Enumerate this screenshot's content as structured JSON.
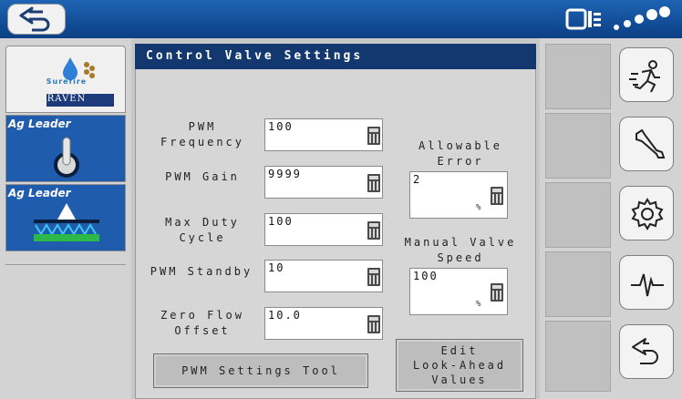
{
  "screen": {
    "title": "Control Valve Settings"
  },
  "topbar": {
    "back_icon": "back-arrow-icon",
    "status_icons": [
      "module-icon",
      "signal-icon"
    ]
  },
  "left_panel": {
    "items": [
      {
        "brand": "Surefire",
        "sub": "RAVEN",
        "icon": "surefire-raven-logo"
      },
      {
        "brand": "Ag Leader",
        "icon": "toggle-switch-icon"
      },
      {
        "brand": "Ag Leader",
        "icon": "sprayer-boom-icon"
      }
    ]
  },
  "fields": {
    "pwm_frequency": {
      "label_line1": "PWM",
      "label_line2": "Frequency",
      "value": "100"
    },
    "pwm_gain": {
      "label": "PWM Gain",
      "value": "9999"
    },
    "max_duty_cycle": {
      "label_line1": "Max Duty",
      "label_line2": "Cycle",
      "value": "100"
    },
    "pwm_standby": {
      "label": "PWM Standby",
      "value": "10"
    },
    "zero_flow_offset": {
      "label_line1": "Zero Flow",
      "label_line2": "Offset",
      "value": "10.0"
    },
    "allowable_error": {
      "label_line1": "Allowable",
      "label_line2": "Error",
      "value": "2",
      "unit": "%"
    },
    "manual_valve_speed": {
      "label_line1": "Manual Valve",
      "label_line2": "Speed",
      "value": "100",
      "unit": "%"
    }
  },
  "buttons": {
    "pwm_settings_tool": "PWM Settings Tool",
    "edit_look_ahead": {
      "line1": "Edit",
      "line2": "Look-Ahead",
      "line3": "Values"
    }
  },
  "right_bar": {
    "buttons": [
      "running-person-icon",
      "wrench-icon",
      "gear-icon",
      "waveform-icon",
      "back-arrow-icon"
    ]
  },
  "colors": {
    "topbar": "#0a3f84",
    "title_bar": "#12386f"
  }
}
